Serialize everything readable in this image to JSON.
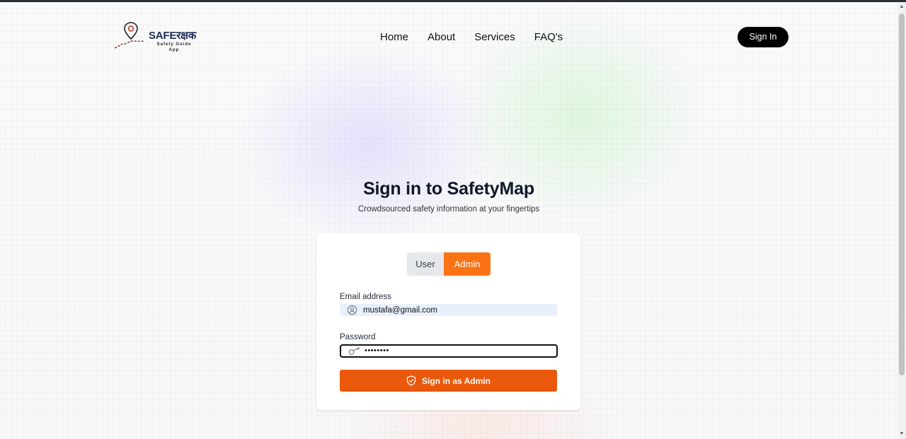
{
  "brand": {
    "name": "SAFEरक्षक",
    "tagline_line1": "Safety Guide",
    "tagline_line2": "App",
    "color": "#1c2b55"
  },
  "nav": {
    "items": [
      "Home",
      "About",
      "Services",
      "FAQ's"
    ]
  },
  "header": {
    "signin_label": "Sign In"
  },
  "hero": {
    "title": "Sign in to SafetyMap",
    "subtitle": "Crowdsourced safety information at your fingertips"
  },
  "form": {
    "roles": {
      "user_label": "User",
      "admin_label": "Admin",
      "selected": "Admin"
    },
    "email": {
      "label": "Email address",
      "value": "mustafa@gmail.com",
      "icon": "user-circle-icon"
    },
    "password": {
      "label": "Password",
      "masked_value": "••••••••",
      "icon": "key-icon"
    },
    "submit": {
      "label": "Sign in as Admin",
      "icon": "shield-check-icon"
    }
  },
  "colors": {
    "accent": "#f97316",
    "button": "#ea580c",
    "dark": "#000000"
  }
}
